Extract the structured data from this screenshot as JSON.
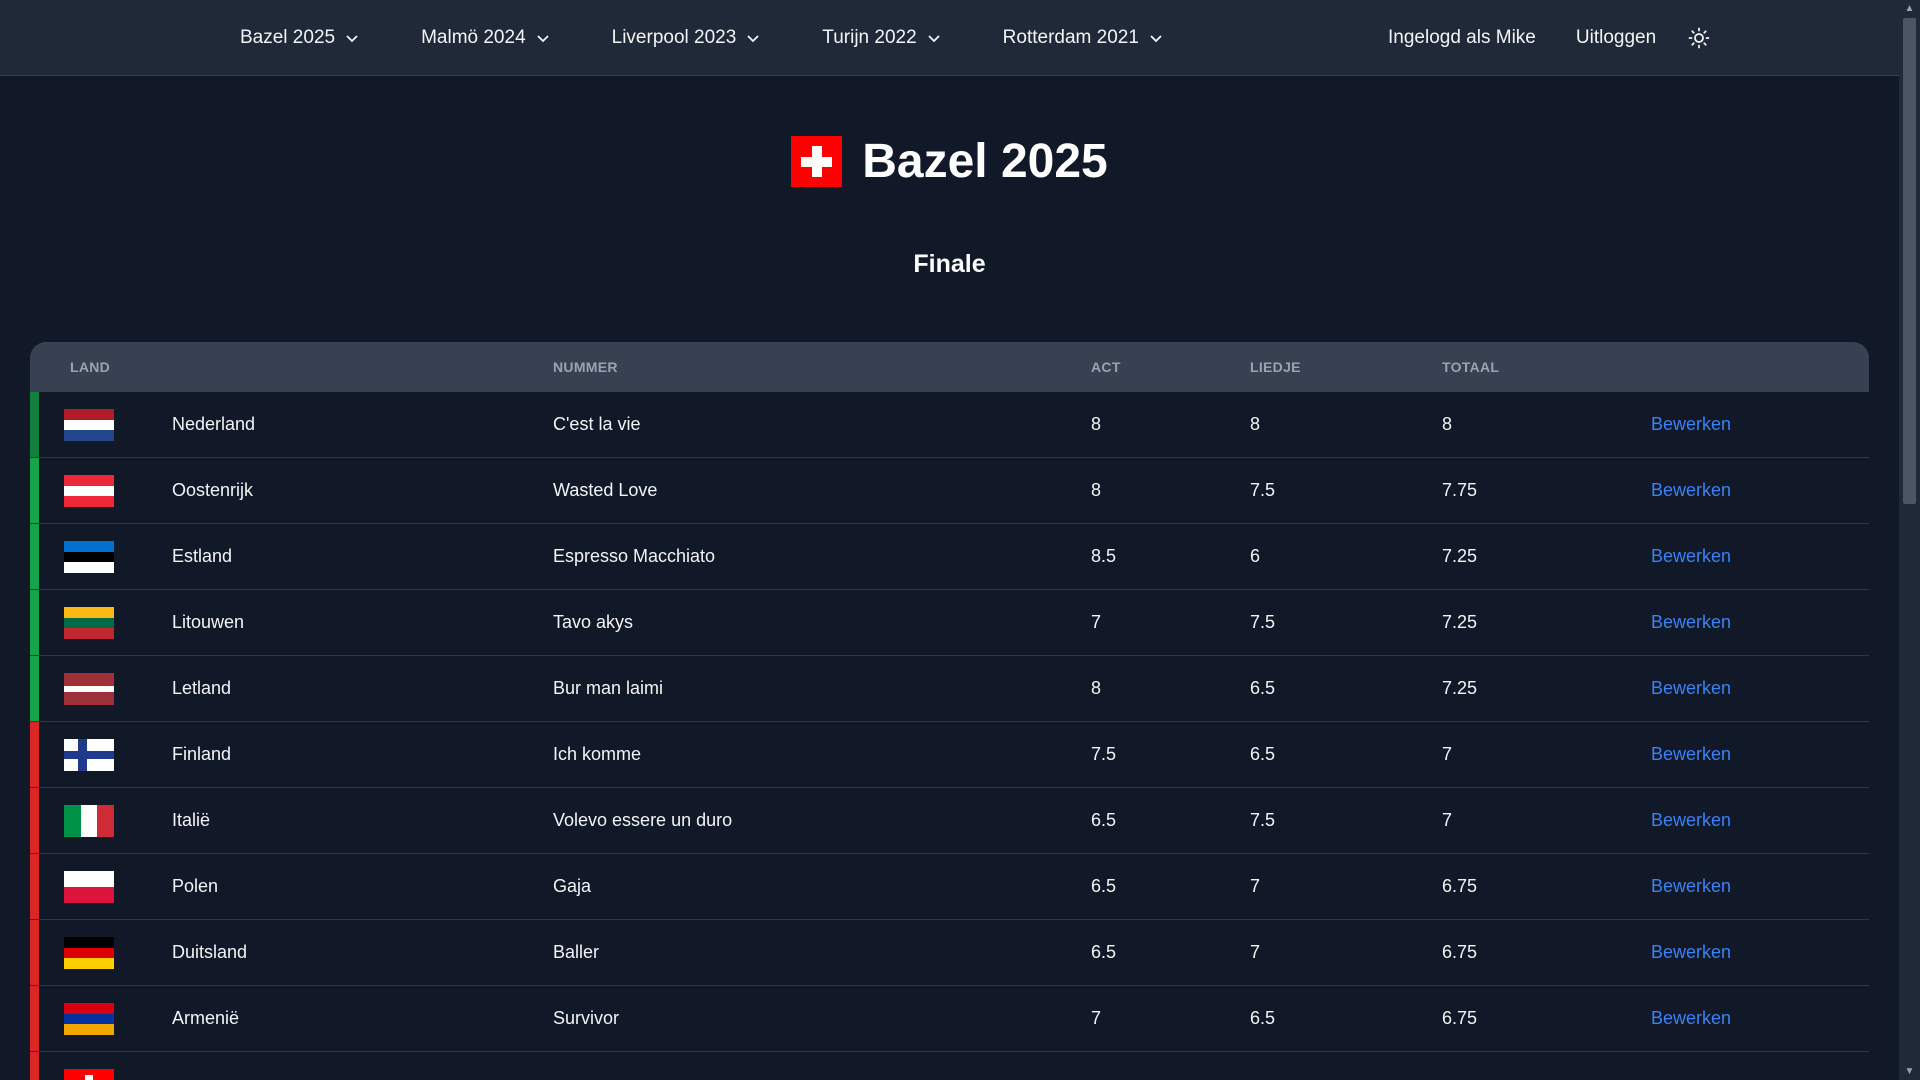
{
  "nav": {
    "items": [
      {
        "label": "Bazel 2025"
      },
      {
        "label": "Malmö 2024"
      },
      {
        "label": "Liverpool 2023"
      },
      {
        "label": "Turijn 2022"
      },
      {
        "label": "Rotterdam 2021"
      }
    ],
    "user_label": "Ingelogd als Mike",
    "logout_label": "Uitloggen",
    "theme_icon": "sun-icon"
  },
  "page": {
    "title": "Bazel 2025",
    "section": "Finale"
  },
  "table": {
    "headers": {
      "land": "LAND",
      "nummer": "NUMMER",
      "act": "ACT",
      "liedje": "LIEDJE",
      "totaal": "TOTAAL"
    },
    "edit_label": "Bewerken",
    "rows": [
      {
        "land": "Nederland",
        "nummer": "C'est la vie",
        "act": "8",
        "liedje": "8",
        "totaal": "8",
        "status": "qualified"
      },
      {
        "land": "Oostenrijk",
        "nummer": "Wasted Love",
        "act": "8",
        "liedje": "7.5",
        "totaal": "7.75",
        "status": "qualified"
      },
      {
        "land": "Estland",
        "nummer": "Espresso Macchiato",
        "act": "8.5",
        "liedje": "6",
        "totaal": "7.25",
        "status": "qualified"
      },
      {
        "land": "Litouwen",
        "nummer": "Tavo akys",
        "act": "7",
        "liedje": "7.5",
        "totaal": "7.25",
        "status": "qualified"
      },
      {
        "land": "Letland",
        "nummer": "Bur man laimi",
        "act": "8",
        "liedje": "6.5",
        "totaal": "7.25",
        "status": "qualified"
      },
      {
        "land": "Finland",
        "nummer": "Ich komme",
        "act": "7.5",
        "liedje": "6.5",
        "totaal": "7",
        "status": "not-qualified"
      },
      {
        "land": "Italië",
        "nummer": "Volevo essere un duro",
        "act": "6.5",
        "liedje": "7.5",
        "totaal": "7",
        "status": "not-qualified"
      },
      {
        "land": "Polen",
        "nummer": "Gaja",
        "act": "6.5",
        "liedje": "7",
        "totaal": "6.75",
        "status": "not-qualified"
      },
      {
        "land": "Duitsland",
        "nummer": "Baller",
        "act": "6.5",
        "liedje": "7",
        "totaal": "6.75",
        "status": "not-qualified"
      },
      {
        "land": "Armenië",
        "nummer": "Survivor",
        "act": "7",
        "liedje": "6.5",
        "totaal": "6.75",
        "status": "not-qualified"
      }
    ]
  },
  "colors": {
    "background": "#111827",
    "navbar": "#1f2937",
    "header_row": "#374151",
    "link": "#3b82f6",
    "qualified_bar": "#16a34a",
    "top_bar": "#15803d",
    "not_qualified_bar": "#dc2626"
  }
}
